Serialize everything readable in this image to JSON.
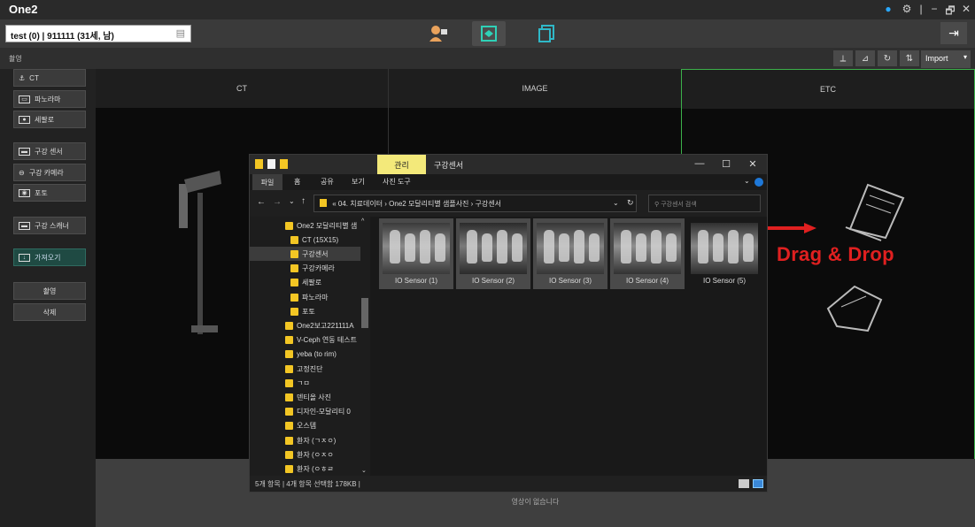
{
  "app": {
    "title": "One2",
    "window_controls": [
      "●",
      "⚙",
      "|",
      "−",
      "🗗",
      "✕"
    ]
  },
  "patient": {
    "info": "test  (0) | 911111 (31세, 남)",
    "menu_icon": "list-icon"
  },
  "toolbar": {
    "modes": [
      "patient-icon",
      "layers-icon",
      "export-icon"
    ],
    "exit_icon": "exit-icon"
  },
  "subbar": {
    "capture_label": "촬영",
    "tools": [
      "flip-v-icon",
      "flip-h-icon",
      "rotate-icon",
      "swap-icon"
    ],
    "import_label": "Import"
  },
  "sidebar": {
    "items": [
      {
        "label": "CT",
        "icon": "ct-icon"
      },
      {
        "label": "파노라마",
        "icon": "panorama-icon"
      },
      {
        "label": "세팔로",
        "icon": "cephalo-icon"
      },
      {
        "label": "구강 센서",
        "icon": "sensor-icon"
      },
      {
        "label": "구강 카메라",
        "icon": "camera-icon"
      },
      {
        "label": "포토",
        "icon": "photo-icon"
      },
      {
        "label": "구강 스캐너",
        "icon": "scanner-icon"
      },
      {
        "label": "가져오기",
        "icon": "import-icon"
      },
      {
        "label": "촬영"
      },
      {
        "label": "삭제"
      }
    ]
  },
  "panels": [
    {
      "label": "CT"
    },
    {
      "label": "IMAGE"
    },
    {
      "label": "ETC"
    }
  ],
  "overlay": {
    "drag_drop": "Drag & Drop",
    "color": "#e02020"
  },
  "status": {
    "message": "영상이 없습니다"
  },
  "explorer": {
    "manage_tab": "관리",
    "title": "구강센서",
    "ribbon_tabs": [
      "파일",
      "홈",
      "공유",
      "보기",
      "사진 도구"
    ],
    "address": "« 04. 치료데이터 › One2 모달리티별 샘플사진 › 구강센서",
    "search_placeholder": "구강센서 검색",
    "tree": [
      {
        "label": "One2 모달리티별 샘",
        "indent": 1
      },
      {
        "label": "CT (15X15)",
        "indent": 2
      },
      {
        "label": "구강센서",
        "indent": 2,
        "selected": true
      },
      {
        "label": "구강카메라",
        "indent": 2
      },
      {
        "label": "세팔로",
        "indent": 2
      },
      {
        "label": "파노라마",
        "indent": 2
      },
      {
        "label": "포토",
        "indent": 2
      },
      {
        "label": "One2보고221111A",
        "indent": 1
      },
      {
        "label": "V-Ceph 연동 테스트",
        "indent": 1
      },
      {
        "label": "yeba (to rim)",
        "indent": 1
      },
      {
        "label": "고정진단",
        "indent": 1
      },
      {
        "label": "ㄱㅁ",
        "indent": 1
      },
      {
        "label": "덴티올 사진",
        "indent": 1
      },
      {
        "label": "디자인-모달리티 0",
        "indent": 1
      },
      {
        "label": "오스템",
        "indent": 1
      },
      {
        "label": "환자 (ㄱㅈㅇ)",
        "indent": 1
      },
      {
        "label": "환자 (ㅇㅈㅇ",
        "indent": 1
      },
      {
        "label": "환자 (ㅇㅎㄹ",
        "indent": 1
      }
    ],
    "files": [
      {
        "name": "IO Sensor (1)",
        "selected": true
      },
      {
        "name": "IO Sensor (2)",
        "selected": true
      },
      {
        "name": "IO Sensor (3)",
        "selected": true
      },
      {
        "name": "IO Sensor (4)",
        "selected": true
      },
      {
        "name": "IO Sensor (5)",
        "selected": false
      }
    ],
    "status_text": "5개 항목  |  4개 항목 선택함 178KB  |"
  }
}
